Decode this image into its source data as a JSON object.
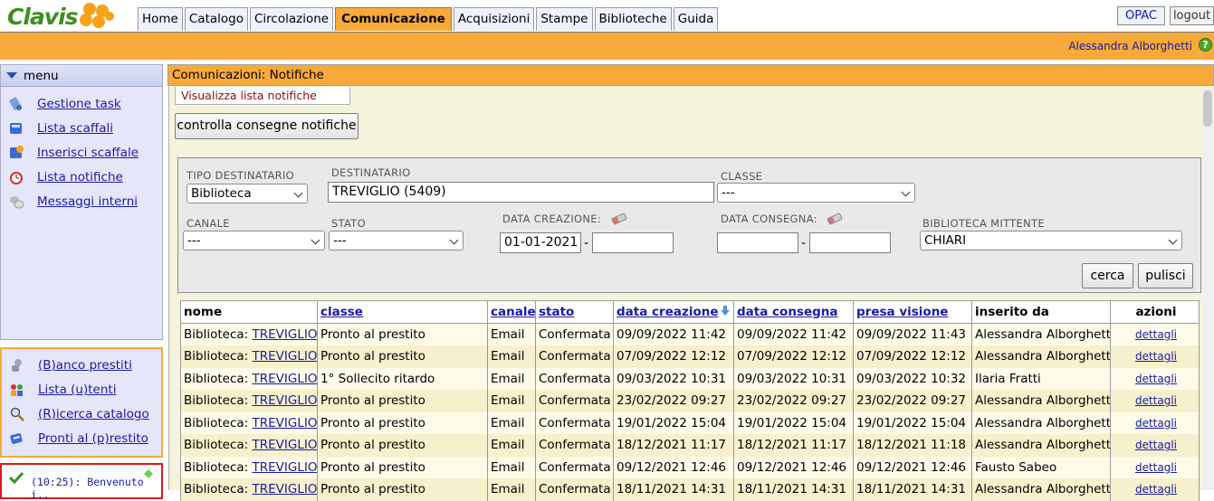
{
  "app": {
    "logo_text": "Clavis"
  },
  "nav_tabs": [
    "Home",
    "Catalogo",
    "Circolazione",
    "Comunicazione",
    "Acquisizioni",
    "Stampe",
    "Biblioteche",
    "Guida"
  ],
  "active_tab": "Comunicazione",
  "header": {
    "opac": "OPAC",
    "logout": "logout",
    "user": "Alessandra Alborghetti",
    "help": "?"
  },
  "sidebar": {
    "menu_title": "menu",
    "items": [
      {
        "label": "Gestione task",
        "icon": "task-icon"
      },
      {
        "label": "Lista scaffali",
        "icon": "shelf-list-icon"
      },
      {
        "label": "Inserisci scaffale",
        "icon": "add-shelf-icon"
      },
      {
        "label": "Lista notifiche",
        "icon": "alarm-clock-icon"
      },
      {
        "label": "Messaggi interni",
        "icon": "messages-icon"
      }
    ],
    "quick": [
      {
        "label": "(B)anco prestiti",
        "icon": "loan-desk-icon"
      },
      {
        "label": "Lista (u)tenti",
        "icon": "users-icon"
      },
      {
        "label": "(R)icerca catalogo",
        "icon": "search-icon"
      },
      {
        "label": "Pronti al (p)restito",
        "icon": "books-icon"
      }
    ],
    "message": "(10:25): Benvenuto i.."
  },
  "breadcrumb": "Comunicazioni: Notifiche",
  "subtab": "Visualizza lista notifiche",
  "check_button": "controlla consegne notifiche",
  "filters": {
    "tipo_destinatario": {
      "label": "TIPO DESTINATARIO",
      "value": "Biblioteca"
    },
    "destinatario": {
      "label": "DESTINATARIO",
      "value": "TREVIGLIO (5409)"
    },
    "classe": {
      "label": "CLASSE",
      "value": "---"
    },
    "canale": {
      "label": "CANALE",
      "value": "---"
    },
    "stato": {
      "label": "STATO",
      "value": "---"
    },
    "data_creazione": {
      "label": "DATA CREAZIONE:",
      "from": "01-01-2021",
      "to": ""
    },
    "data_consegna": {
      "label": "DATA CONSEGNA:",
      "from": "",
      "to": ""
    },
    "biblioteca_mittente": {
      "label": "BIBLIOTECA MITTENTE",
      "value": "CHIARI"
    },
    "separator": "-",
    "search_button": "cerca",
    "clear_button": "pulisci"
  },
  "table": {
    "headers": [
      "nome",
      "classe",
      "canale",
      "stato",
      "data creazione",
      "data consegna",
      "presa visione",
      "inserito da",
      "azioni"
    ],
    "rows": [
      {
        "nome_prefix": "Biblioteca:",
        "nome_link": "TREVIGLIO",
        "classe": "Pronto al prestito",
        "canale": "Email",
        "stato": "Confermata",
        "creazione": "09/09/2022 11:42",
        "consegna": "09/09/2022 11:42",
        "visione": "09/09/2022 11:43",
        "inserito": "Alessandra Alborghetti",
        "azione": "dettagli"
      },
      {
        "nome_prefix": "Biblioteca:",
        "nome_link": "TREVIGLIO",
        "classe": "Pronto al prestito",
        "canale": "Email",
        "stato": "Confermata",
        "creazione": "07/09/2022 12:12",
        "consegna": "07/09/2022 12:12",
        "visione": "07/09/2022 12:12",
        "inserito": "Alessandra Alborghetti",
        "azione": "dettagli"
      },
      {
        "nome_prefix": "Biblioteca:",
        "nome_link": "TREVIGLIO",
        "classe": "1° Sollecito ritardo",
        "canale": "Email",
        "stato": "Confermata",
        "creazione": "09/03/2022 10:31",
        "consegna": "09/03/2022 10:31",
        "visione": "09/03/2022 10:32",
        "inserito": "Ilaria Fratti",
        "azione": "dettagli"
      },
      {
        "nome_prefix": "Biblioteca:",
        "nome_link": "TREVIGLIO",
        "classe": "Pronto al prestito",
        "canale": "Email",
        "stato": "Confermata",
        "creazione": "23/02/2022 09:27",
        "consegna": "23/02/2022 09:27",
        "visione": "23/02/2022 09:27",
        "inserito": "Alessandra Alborghetti",
        "azione": "dettagli"
      },
      {
        "nome_prefix": "Biblioteca:",
        "nome_link": "TREVIGLIO",
        "classe": "Pronto al prestito",
        "canale": "Email",
        "stato": "Confermata",
        "creazione": "19/01/2022 15:04",
        "consegna": "19/01/2022 15:04",
        "visione": "19/01/2022 15:04",
        "inserito": "Alessandra Alborghetti",
        "azione": "dettagli"
      },
      {
        "nome_prefix": "Biblioteca:",
        "nome_link": "TREVIGLIO",
        "classe": "Pronto al prestito",
        "canale": "Email",
        "stato": "Confermata",
        "creazione": "18/12/2021 11:17",
        "consegna": "18/12/2021 11:17",
        "visione": "18/12/2021 11:18",
        "inserito": "Alessandra Alborghetti",
        "azione": "dettagli"
      },
      {
        "nome_prefix": "Biblioteca:",
        "nome_link": "TREVIGLIO",
        "classe": "Pronto al prestito",
        "canale": "Email",
        "stato": "Confermata",
        "creazione": "09/12/2021 12:46",
        "consegna": "09/12/2021 12:46",
        "visione": "09/12/2021 12:46",
        "inserito": "Fausto Sabeo",
        "azione": "dettagli"
      },
      {
        "nome_prefix": "Biblioteca:",
        "nome_link": "TREVIGLIO",
        "classe": "Pronto al prestito",
        "canale": "Email",
        "stato": "Confermata",
        "creazione": "18/11/2021 14:31",
        "consegna": "18/11/2021 14:31",
        "visione": "18/11/2021 14:31",
        "inserito": "Alessandra Alborghetti",
        "azione": "dettagli"
      }
    ]
  }
}
